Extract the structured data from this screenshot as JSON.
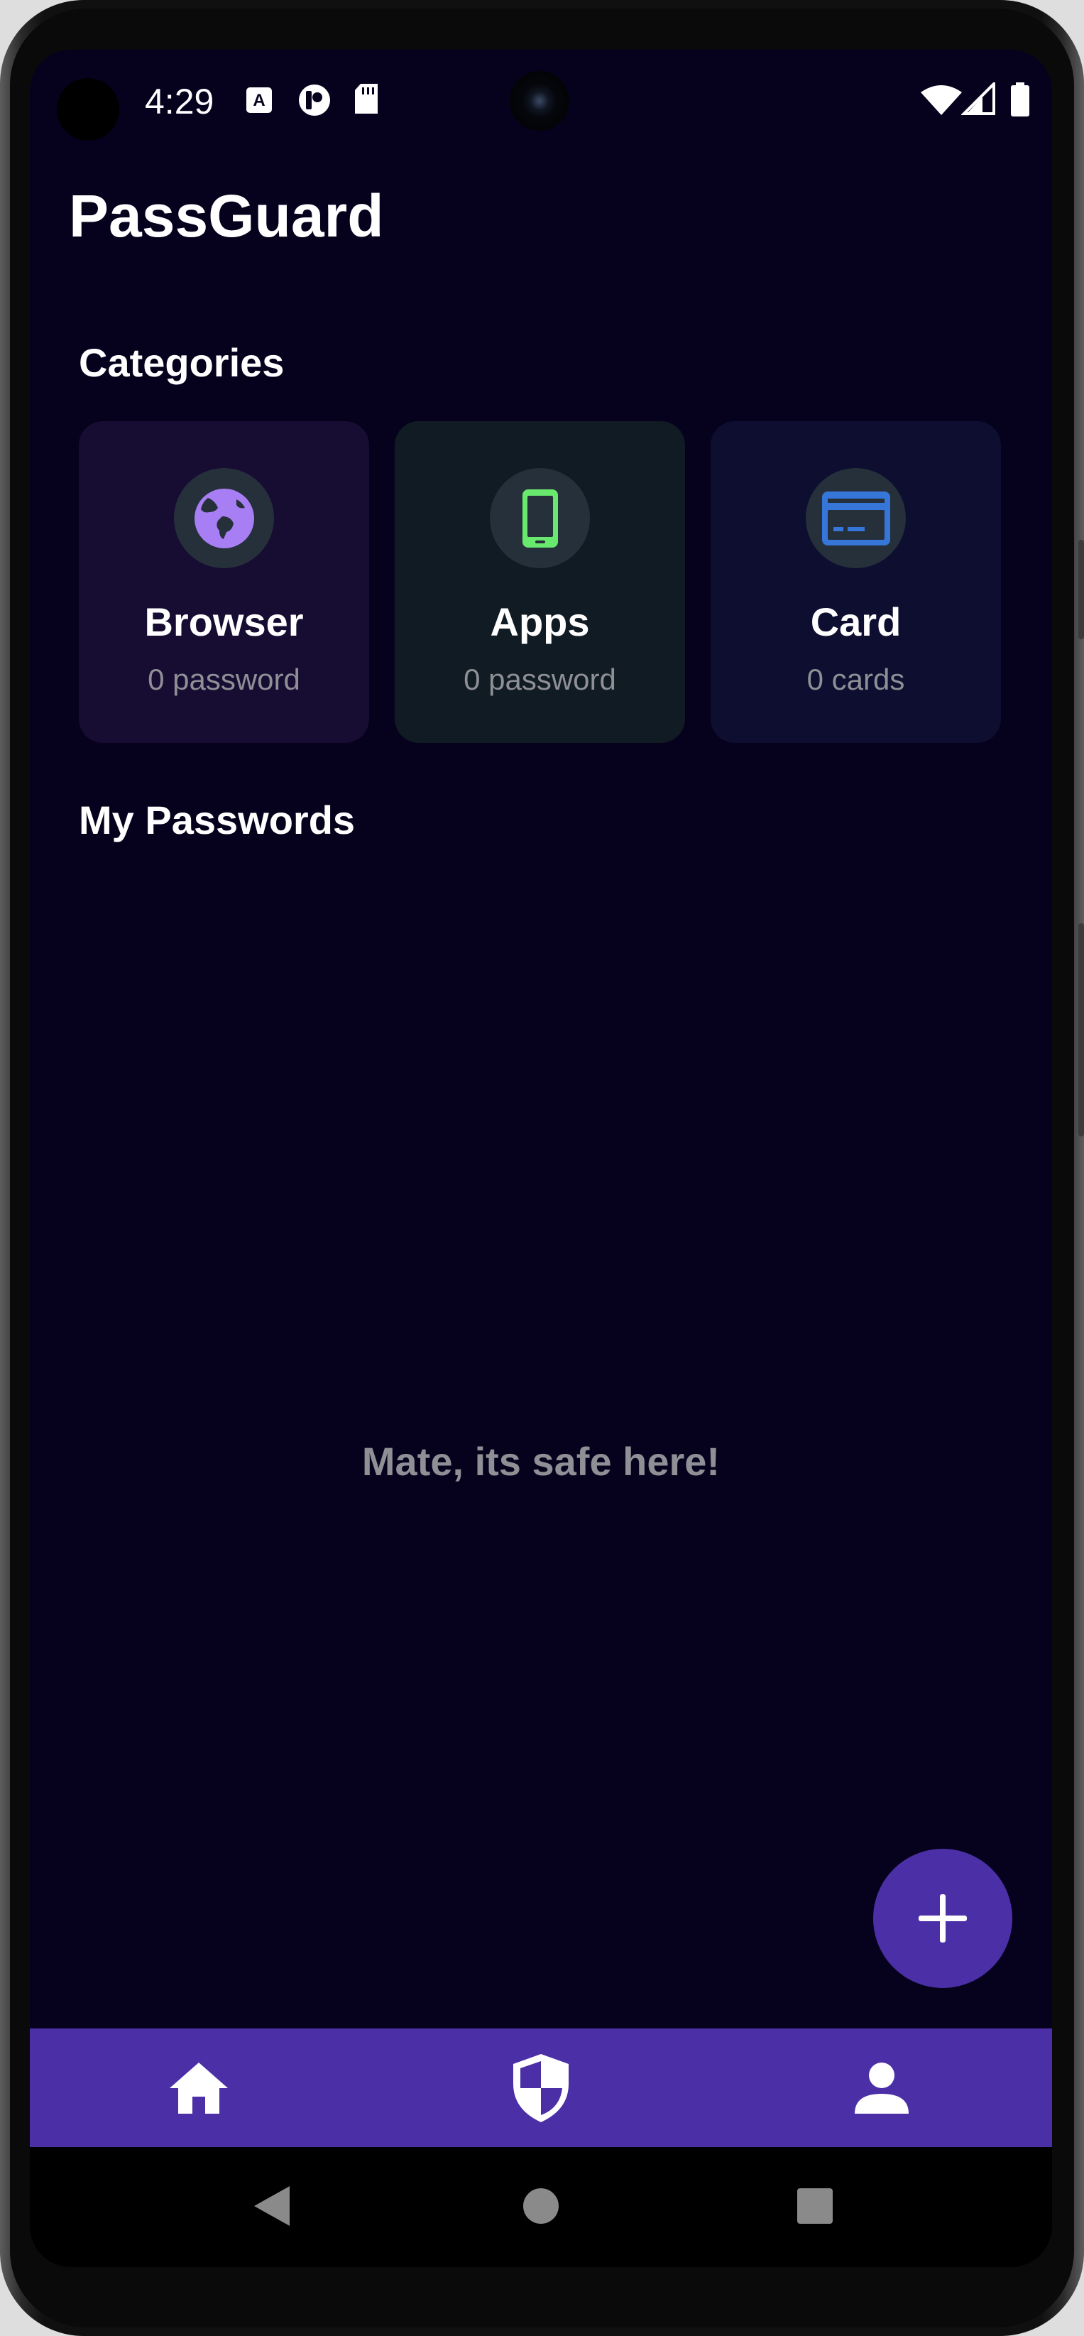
{
  "status_bar": {
    "time": "4:29",
    "left_icons": [
      "font-icon",
      "circle-status-icon",
      "sd-card-icon"
    ],
    "right_icons": [
      "wifi-icon",
      "signal-icon",
      "battery-icon"
    ]
  },
  "app": {
    "title": "PassGuard"
  },
  "categories": {
    "heading": "Categories",
    "items": [
      {
        "title": "Browser",
        "count": "0 password",
        "icon": "globe-icon",
        "icon_color": "#a77ef3",
        "card_bg": "#170d33"
      },
      {
        "title": "Apps",
        "count": "0 password",
        "icon": "phone-icon",
        "icon_color": "#68e86d",
        "card_bg": "#111b24"
      },
      {
        "title": "Card",
        "count": "0 cards",
        "icon": "credit-card-icon",
        "icon_color": "#3576d8",
        "card_bg": "#0d0e30"
      }
    ]
  },
  "passwords": {
    "heading": "My Passwords",
    "empty_message": "Mate, its safe here!"
  },
  "fab": {
    "icon": "plus-icon"
  },
  "bottom_nav": {
    "items": [
      {
        "icon": "home-icon"
      },
      {
        "icon": "shield-icon"
      },
      {
        "icon": "profile-icon"
      }
    ]
  },
  "system_nav": {
    "items": [
      "back-icon",
      "home-circle-icon",
      "recents-icon"
    ]
  },
  "colors": {
    "background": "#06021d",
    "accent": "#4b2fa7",
    "muted_text": "#8f8f96"
  }
}
